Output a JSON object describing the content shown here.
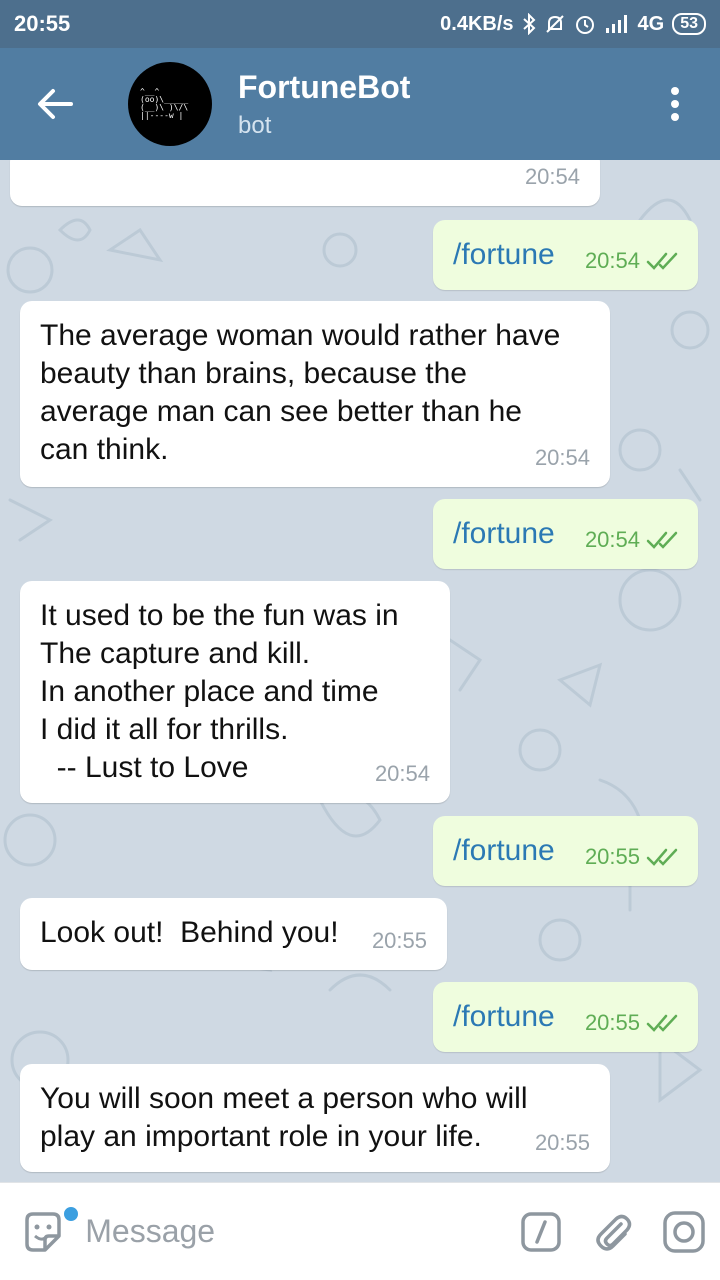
{
  "status_bar": {
    "time": "20:55",
    "net_speed": "0.4KB/s",
    "network": "4G",
    "battery": "53"
  },
  "header": {
    "title": "FortuneBot",
    "subtitle": "bot"
  },
  "messages": [
    {
      "type": "in",
      "text": "",
      "time": "20:54"
    },
    {
      "type": "out",
      "text": "/fortune",
      "time": "20:54"
    },
    {
      "type": "in",
      "text": "The average woman would rather have\nbeauty than brains, because the\naverage man can see better than he\ncan think.",
      "time": "20:54"
    },
    {
      "type": "out",
      "text": "/fortune",
      "time": "20:54"
    },
    {
      "type": "in",
      "text": "It used to be the fun was in\nThe capture and kill.\nIn another place and time\nI did it all for thrills.\n  -- Lust to Love",
      "time": "20:54"
    },
    {
      "type": "out",
      "text": "/fortune",
      "time": "20:55"
    },
    {
      "type": "in",
      "text": "Look out!  Behind you!",
      "time": "20:55"
    },
    {
      "type": "out",
      "text": "/fortune",
      "time": "20:55"
    },
    {
      "type": "in",
      "text": "You will soon meet a person who will\nplay an important role in your life.",
      "time": "20:55"
    }
  ],
  "input": {
    "placeholder": "Message"
  },
  "icons": {
    "back": "arrow-left-icon",
    "menu": "more-vertical-icon",
    "sticker": "sticker-icon",
    "command": "slash-command-icon",
    "attach": "paperclip-icon",
    "camera": "camera-icon"
  },
  "colors": {
    "header": "#517da2",
    "status_bar": "#4d6f8d",
    "outgoing_bubble": "#effdde",
    "outgoing_text": "#2b79b4",
    "time_outgoing": "#5fad55",
    "chat_bg": "#cfd9e3"
  }
}
